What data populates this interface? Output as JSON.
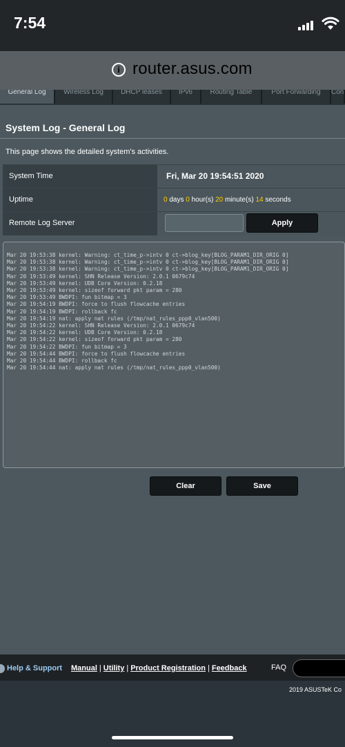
{
  "status_bar": {
    "time": "7:54"
  },
  "browser": {
    "url": "router.asus.com"
  },
  "tabs": [
    "General Log",
    "Wireless Log",
    "DHCP leases",
    "IPv6",
    "Routing Table",
    "Port Forwarding",
    "Connections"
  ],
  "page": {
    "title": "System Log - General Log",
    "description": "This page shows the detailed system's activities."
  },
  "info": {
    "system_time_label": "System Time",
    "system_time_value": "Fri, Mar 20 19:54:51 2020",
    "uptime_label": "Uptime",
    "uptime": {
      "days": "0",
      "days_unit": "days",
      "hours": "0",
      "hours_unit": "hour(s)",
      "minutes": "20",
      "minutes_unit": "minute(s)",
      "seconds": "14",
      "seconds_unit": "seconds"
    },
    "remote_log_label": "Remote Log Server",
    "remote_log_value": "",
    "apply_label": "Apply"
  },
  "log_lines": [
    "Mar 20 19:53:38 kernel: Warning: ct_time_p->intv 0 ct->blog_key[BLOG_PARAM1_DIR_ORIG 0]",
    "Mar 20 19:53:38 kernel: Warning: ct_time_p->intv 0 ct->blog_key[BLOG_PARAM1_DIR_ORIG 0]",
    "Mar 20 19:53:38 kernel: Warning: ct_time_p->intv 0 ct->blog_key[BLOG_PARAM1_DIR_ORIG 0]",
    "Mar 20 19:53:49 kernel: SHN Release Version: 2.0.1 0679c74",
    "Mar 20 19:53:49 kernel: UDB Core Version: 0.2.18",
    "Mar 20 19:53:49 kernel: sizeof forward pkt param = 280",
    "Mar 20 19:53:49 BWDPI: fun bitmap = 3",
    "Mar 20 19:54:19 BWDPI: force to flush flowcache entries",
    "Mar 20 19:54:19 BWDPI: rollback fc",
    "Mar 20 19:54:19 nat: apply nat rules (/tmp/nat_rules_ppp0_vlan500)",
    "Mar 20 19:54:22 kernel: SHN Release Version: 2.0.1 0679c74",
    "Mar 20 19:54:22 kernel: UDB Core Version: 0.2.18",
    "Mar 20 19:54:22 kernel: sizeof forward pkt param = 280",
    "Mar 20 19:54:22 BWDPI: fun bitmap = 3",
    "Mar 20 19:54:44 BWDPI: force to flush flowcache entries",
    "Mar 20 19:54:44 BWDPI: rollback fc",
    "Mar 20 19:54:44 nat: apply nat rules (/tmp/nat_rules_ppp0_vlan500)"
  ],
  "buttons": {
    "clear": "Clear",
    "save": "Save"
  },
  "footer": {
    "help": "Help & Support",
    "manual": "Manual",
    "utility": "Utility",
    "product_registration": "Product Registration",
    "feedback": "Feedback",
    "sep": "|",
    "faq": "FAQ",
    "copyright": "2019 ASUSTeK Co"
  },
  "colors": {
    "accent_value": "#ffcc00",
    "help_link": "#9bc9f0"
  }
}
